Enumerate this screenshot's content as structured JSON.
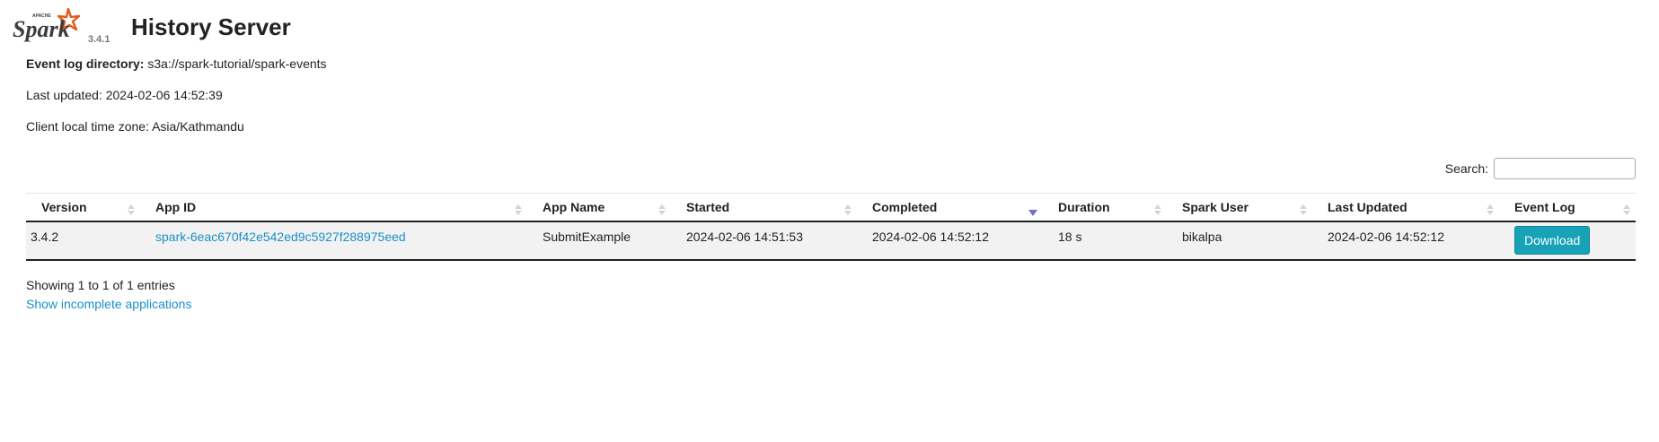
{
  "header": {
    "logo_version": "3.4.1",
    "title": "History Server"
  },
  "info": {
    "event_log_label": "Event log directory:",
    "event_log_value": "s3a://spark-tutorial/spark-events",
    "last_updated": "Last updated: 2024-02-06 14:52:39",
    "timezone": "Client local time zone: Asia/Kathmandu"
  },
  "search": {
    "label": "Search:",
    "value": ""
  },
  "table": {
    "columns": [
      "Version",
      "App ID",
      "App Name",
      "Started",
      "Completed",
      "Duration",
      "Spark User",
      "Last Updated",
      "Event Log"
    ],
    "sorted_column": "Completed",
    "sort_direction": "descending",
    "rows": [
      {
        "version": "3.4.2",
        "app_id": "spark-6eac670f42e542ed9c5927f288975eed",
        "app_name": "SubmitExample",
        "started": "2024-02-06 14:51:53",
        "completed": "2024-02-06 14:52:12",
        "duration": "18 s",
        "spark_user": "bikalpa",
        "last_updated": "2024-02-06 14:52:12",
        "event_log": "Download"
      }
    ]
  },
  "footer": {
    "showing": "Showing 1 to 1 of 1 entries",
    "show_incomplete": "Show incomplete applications"
  },
  "colors": {
    "link": "#1a8fc8",
    "download_button": "#17a2b8",
    "logo_orange": "#e25a1c",
    "sort_active": "#6f6fcf"
  }
}
